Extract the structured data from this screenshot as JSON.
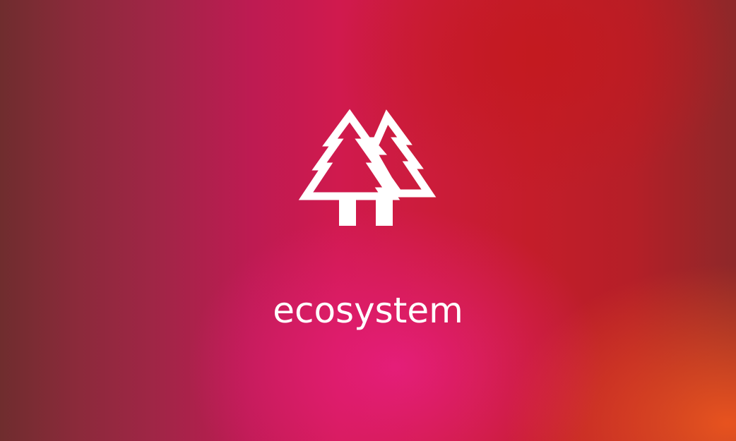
{
  "caption": "ecosystem",
  "icon": "twin-pine-trees-icon",
  "colors": {
    "text": "#ffffff",
    "icon": "#ffffff",
    "gradient_left": "#6f2d2e",
    "gradient_center_magenta": "#e81e82",
    "gradient_right_red": "#c41d2a",
    "gradient_bottom_right_orange": "#ec551e"
  }
}
